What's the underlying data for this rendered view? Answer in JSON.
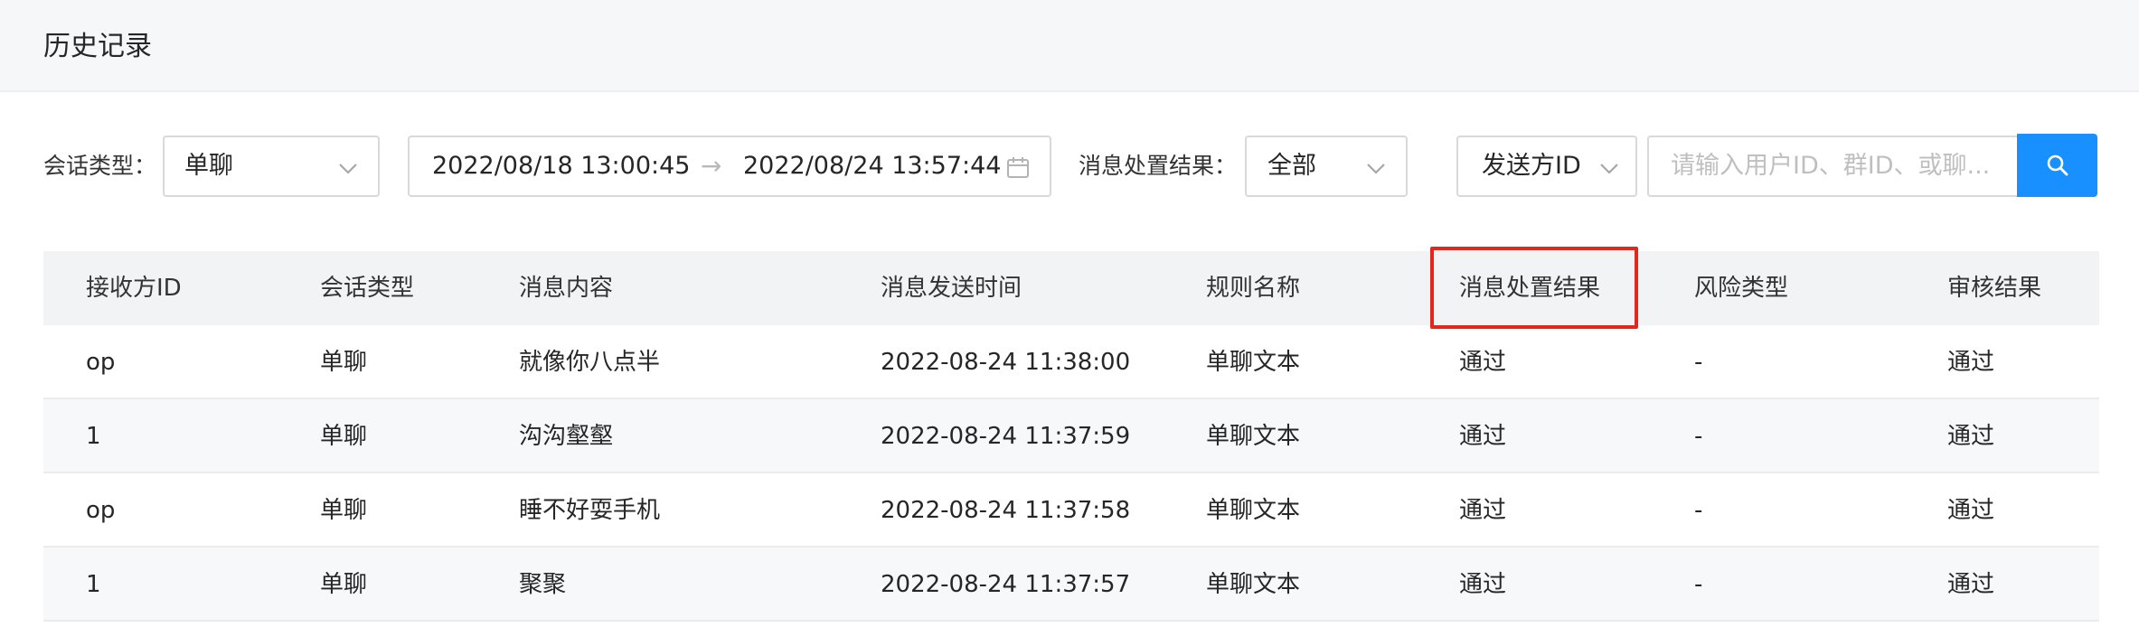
{
  "header": {
    "title": "历史记录"
  },
  "filters": {
    "session_type_label": "会话类型：",
    "session_type_value": "单聊",
    "date_start": "2022/08/18 13:00:45",
    "date_separator": "→",
    "date_end": "2022/08/24 13:57:44",
    "result_label": "消息处置结果：",
    "result_value": "全部",
    "search_field_value": "发送方ID",
    "search_placeholder": "请输入用户ID、群ID、或聊..."
  },
  "table": {
    "columns": [
      "接收方ID",
      "会话类型",
      "消息内容",
      "消息发送时间",
      "规则名称",
      "消息处置结果",
      "风险类型",
      "审核结果"
    ],
    "rows": [
      [
        "op",
        "单聊",
        "就像你八点半",
        "2022-08-24 11:38:00",
        "单聊文本",
        "通过",
        "-",
        "通过"
      ],
      [
        "1",
        "单聊",
        "沟沟壑壑",
        "2022-08-24 11:37:59",
        "单聊文本",
        "通过",
        "-",
        "通过"
      ],
      [
        "op",
        "单聊",
        "睡不好耍手机",
        "2022-08-24 11:37:58",
        "单聊文本",
        "通过",
        "-",
        "通过"
      ],
      [
        "1",
        "单聊",
        "聚聚",
        "2022-08-24 11:37:57",
        "单聊文本",
        "通过",
        "-",
        "通过"
      ]
    ]
  },
  "colors": {
    "accent": "#1890ff",
    "highlight": "#e5261c",
    "header_bg": "#f6f7f9",
    "table_header_bg": "#f2f3f5"
  },
  "icons": {
    "select_arrow": "chevron-down-icon",
    "calendar": "calendar-icon",
    "search": "search-icon"
  }
}
